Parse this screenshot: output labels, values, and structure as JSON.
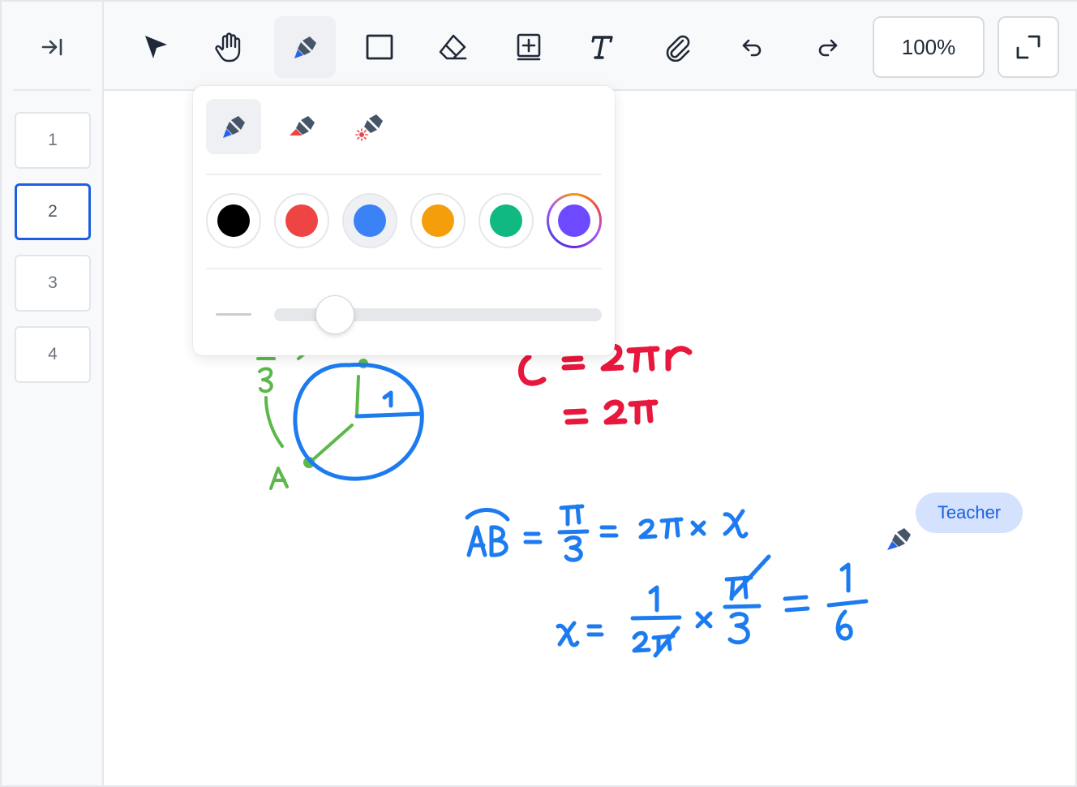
{
  "sidebar": {
    "collapse_icon": "collapse-right-icon",
    "pages": [
      "1",
      "2",
      "3",
      "4"
    ],
    "active_page": "2"
  },
  "toolbar": {
    "tools": [
      "select-icon",
      "hand-icon",
      "pen-icon",
      "rectangle-icon",
      "eraser-icon",
      "add-page-icon",
      "text-icon",
      "attachment-icon",
      "undo-icon",
      "redo-icon"
    ],
    "active_tool": "pen-icon",
    "zoom": "100%",
    "fullscreen_icon": "fullscreen-icon"
  },
  "pen_popup": {
    "pen_types": [
      "pen-icon",
      "highlighter-icon",
      "laser-pointer-icon"
    ],
    "active_pen_type": "pen-icon",
    "colors": [
      "#000000",
      "#ef4444",
      "#3b82f6",
      "#f59e0b",
      "#10b981",
      "#6d4aff"
    ],
    "selected_color": "#3b82f6",
    "stroke_width": 0.17
  },
  "canvas": {
    "handwriting": {
      "green_labels": [
        "3",
        "A"
      ],
      "red_formula": [
        "C = 2πr",
        "= 2π"
      ],
      "circle_radius_label": "1",
      "blue_line_1": "AB = π/3 = 2π × x",
      "blue_line_2": "x = 1/(2π) × π/3 = 1/6"
    }
  },
  "collaborator": {
    "name": "Teacher",
    "color": "#1d5fe0",
    "label_bg": "#d4e2fd"
  }
}
